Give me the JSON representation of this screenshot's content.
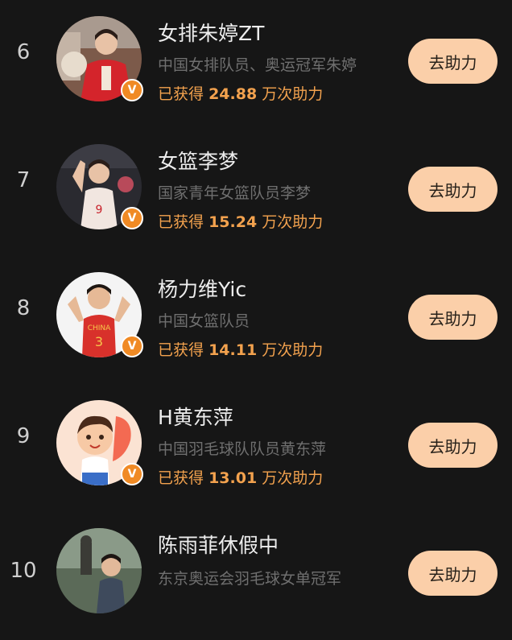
{
  "ranking": [
    {
      "rank": "6",
      "name": "女排朱婷ZT",
      "desc": "中国女排队员、奥运冠军朱婷",
      "count_prefix": "已获得",
      "count_value": "24.88",
      "count_suffix": "万次助力",
      "button": "去助力"
    },
    {
      "rank": "7",
      "name": "女篮李梦",
      "desc": "国家青年女篮队员李梦",
      "count_prefix": "已获得",
      "count_value": "15.24",
      "count_suffix": "万次助力",
      "button": "去助力"
    },
    {
      "rank": "8",
      "name": "杨力维Yic",
      "desc": "中国女篮队员",
      "count_prefix": "已获得",
      "count_value": "14.11",
      "count_suffix": "万次助力",
      "button": "去助力"
    },
    {
      "rank": "9",
      "name": "H黄东萍",
      "desc": "中国羽毛球队队员黄东萍",
      "count_prefix": "已获得",
      "count_value": "13.01",
      "count_suffix": "万次助力",
      "button": "去助力"
    },
    {
      "rank": "10",
      "name": "陈雨菲休假中",
      "desc": "东京奥运会羽毛球女单冠军",
      "count_prefix": "",
      "count_value": "",
      "count_suffix": "",
      "button": "去助力"
    }
  ],
  "icons": {
    "verified_badge": "verified-v-icon",
    "rank_6_avatar": "athlete-photo-red-jersey",
    "rank_7_avatar": "athlete-photo-china-jersey",
    "rank_8_avatar": "athlete-photo-number-3",
    "rank_9_avatar": "cartoon-boy-avatar",
    "rank_10_avatar": "photo-with-statue"
  },
  "colors": {
    "background": "#161616",
    "name_text": "#ededed",
    "desc_text": "#6f6f6f",
    "count_text": "#f3a24e",
    "button_bg": "#fbcfa9",
    "verified_badge": "#f08a24"
  }
}
